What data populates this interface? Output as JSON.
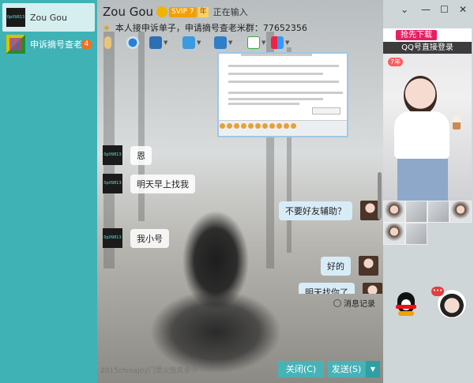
{
  "sessions": [
    {
      "name": "Zou   Gou",
      "avatar": "black-qr-avatar",
      "active": true
    },
    {
      "name": "申诉摘号查老",
      "avatar": "colorful-avatar",
      "active": false,
      "badge": "4"
    }
  ],
  "header": {
    "name": "Zou   Gou",
    "vip": "SVIP 7",
    "year": "年",
    "status": "正在输入",
    "signature": "本人接申诉单子，申请摘号查老米群：77652356"
  },
  "toolbar": {
    "icons": [
      "mic-icon",
      "video-icon",
      "screen-share-icon",
      "file-transfer-icon",
      "remote-desktop-icon",
      "chat-icon",
      "apps-icon"
    ]
  },
  "messages": [
    {
      "from": "other",
      "text": "恩"
    },
    {
      "from": "other",
      "text": "明天早上找我"
    },
    {
      "from": "me",
      "text": "不要好友辅助？"
    },
    {
      "from": "other",
      "text": "我小号"
    },
    {
      "from": "me",
      "text": "好的"
    },
    {
      "from": "me",
      "text": "明天找你了"
    }
  ],
  "input": {
    "history_label": "消息记录",
    "close_label": "关闭(C)",
    "send_label": "发送(S)",
    "footer_text": "2015chinajoy门票火热竞争中"
  },
  "right_panel": {
    "ad_button": "抢先下载",
    "ad_login": "QQ号直接登录",
    "ad_badge": "7年"
  },
  "colors": {
    "accent": "#3fb2b6",
    "send_button": "#47b3b7",
    "badge": "#f36c21"
  }
}
